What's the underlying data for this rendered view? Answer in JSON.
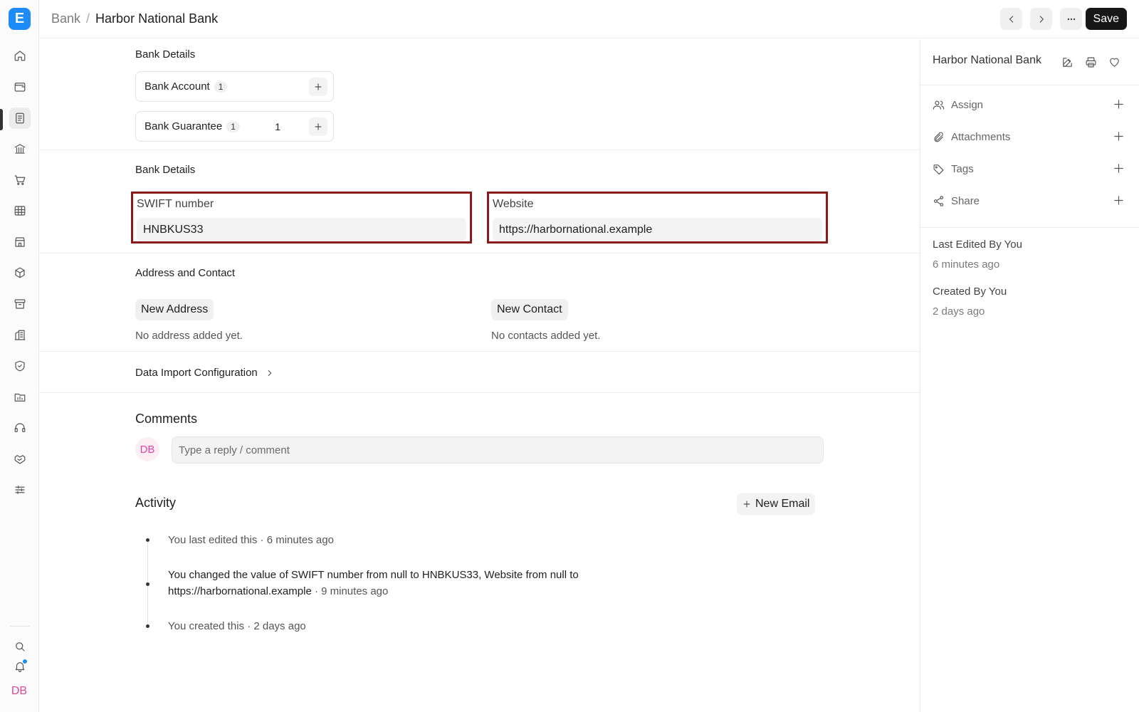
{
  "app": {
    "logo": "E",
    "user_initials": "DB"
  },
  "sidebar": {
    "items": [
      {
        "icon": "home-icon"
      },
      {
        "icon": "wallet-icon"
      },
      {
        "icon": "document-icon"
      },
      {
        "icon": "bank-icon"
      },
      {
        "icon": "cart-icon"
      },
      {
        "icon": "table-icon"
      },
      {
        "icon": "store-icon"
      },
      {
        "icon": "box-icon"
      },
      {
        "icon": "archive-icon"
      },
      {
        "icon": "building-icon"
      },
      {
        "icon": "shield-icon"
      },
      {
        "icon": "folder-chart-icon"
      },
      {
        "icon": "headset-icon"
      },
      {
        "icon": "handshake-icon"
      },
      {
        "icon": "sliders-icon"
      }
    ],
    "bottom": [
      {
        "icon": "search-icon"
      },
      {
        "icon": "bell-icon"
      }
    ]
  },
  "header": {
    "breadcrumb_parent": "Bank",
    "breadcrumb_sep": "/",
    "breadcrumb_current": "Harbor National Bank",
    "save_label": "Save"
  },
  "connections": {
    "title": "Bank Details",
    "cards": [
      {
        "label": "Bank Account",
        "badge": "1",
        "count": ""
      },
      {
        "label": "Bank Guarantee",
        "badge": "1",
        "count": "1"
      }
    ]
  },
  "details": {
    "title": "Bank Details",
    "swift_label": "SWIFT number",
    "swift_value": "HNBKUS33",
    "website_label": "Website",
    "website_value": "https://harbornational.example"
  },
  "address_contact": {
    "title": "Address and Contact",
    "new_address": "New Address",
    "no_address": "No address added yet.",
    "new_contact": "New Contact",
    "no_contacts": "No contacts added yet."
  },
  "data_import": {
    "title": "Data Import Configuration"
  },
  "comments": {
    "title": "Comments",
    "avatar": "DB",
    "placeholder": "Type a reply / comment"
  },
  "activity": {
    "title": "Activity",
    "new_email": "New Email",
    "item1_text": "You last edited this",
    "item1_time": " · 6 minutes ago",
    "item2_line1_a": "You changed the value of SWIFT number from ",
    "item2_null1": "null",
    "item2_to1": " to ",
    "item2_val1": "HNBKUS33",
    "item2_mid": ", Website from ",
    "item2_null2": "null",
    "item2_to2": " to",
    "item2_val2": "https://harbornational.example",
    "item2_time": " · 9 minutes ago",
    "item3_text": "You created this",
    "item3_time": " · 2 days ago"
  },
  "right_panel": {
    "title": "Harbor National Bank",
    "assign": "Assign",
    "attachments": "Attachments",
    "tags": "Tags",
    "share": "Share",
    "last_edited": "Last Edited By You",
    "last_edited_time": "6 minutes ago",
    "created": "Created By You",
    "created_time": "2 days ago"
  }
}
